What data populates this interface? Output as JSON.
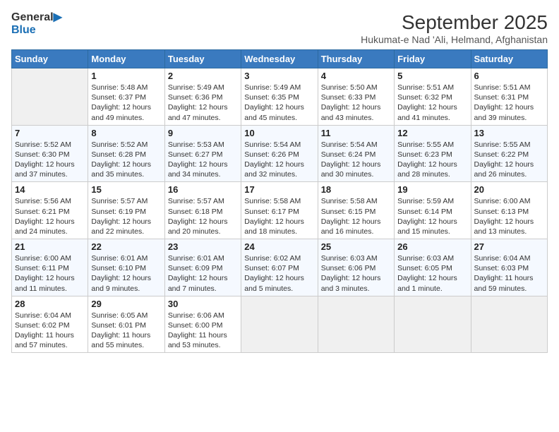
{
  "header": {
    "logo_general": "General",
    "logo_blue": "Blue",
    "month_year": "September 2025",
    "location": "Hukumat-e Nad 'Ali, Helmand, Afghanistan"
  },
  "weekdays": [
    "Sunday",
    "Monday",
    "Tuesday",
    "Wednesday",
    "Thursday",
    "Friday",
    "Saturday"
  ],
  "weeks": [
    [
      {
        "day": "",
        "info": ""
      },
      {
        "day": "1",
        "info": "Sunrise: 5:48 AM\nSunset: 6:37 PM\nDaylight: 12 hours\nand 49 minutes."
      },
      {
        "day": "2",
        "info": "Sunrise: 5:49 AM\nSunset: 6:36 PM\nDaylight: 12 hours\nand 47 minutes."
      },
      {
        "day": "3",
        "info": "Sunrise: 5:49 AM\nSunset: 6:35 PM\nDaylight: 12 hours\nand 45 minutes."
      },
      {
        "day": "4",
        "info": "Sunrise: 5:50 AM\nSunset: 6:33 PM\nDaylight: 12 hours\nand 43 minutes."
      },
      {
        "day": "5",
        "info": "Sunrise: 5:51 AM\nSunset: 6:32 PM\nDaylight: 12 hours\nand 41 minutes."
      },
      {
        "day": "6",
        "info": "Sunrise: 5:51 AM\nSunset: 6:31 PM\nDaylight: 12 hours\nand 39 minutes."
      }
    ],
    [
      {
        "day": "7",
        "info": "Sunrise: 5:52 AM\nSunset: 6:30 PM\nDaylight: 12 hours\nand 37 minutes."
      },
      {
        "day": "8",
        "info": "Sunrise: 5:52 AM\nSunset: 6:28 PM\nDaylight: 12 hours\nand 35 minutes."
      },
      {
        "day": "9",
        "info": "Sunrise: 5:53 AM\nSunset: 6:27 PM\nDaylight: 12 hours\nand 34 minutes."
      },
      {
        "day": "10",
        "info": "Sunrise: 5:54 AM\nSunset: 6:26 PM\nDaylight: 12 hours\nand 32 minutes."
      },
      {
        "day": "11",
        "info": "Sunrise: 5:54 AM\nSunset: 6:24 PM\nDaylight: 12 hours\nand 30 minutes."
      },
      {
        "day": "12",
        "info": "Sunrise: 5:55 AM\nSunset: 6:23 PM\nDaylight: 12 hours\nand 28 minutes."
      },
      {
        "day": "13",
        "info": "Sunrise: 5:55 AM\nSunset: 6:22 PM\nDaylight: 12 hours\nand 26 minutes."
      }
    ],
    [
      {
        "day": "14",
        "info": "Sunrise: 5:56 AM\nSunset: 6:21 PM\nDaylight: 12 hours\nand 24 minutes."
      },
      {
        "day": "15",
        "info": "Sunrise: 5:57 AM\nSunset: 6:19 PM\nDaylight: 12 hours\nand 22 minutes."
      },
      {
        "day": "16",
        "info": "Sunrise: 5:57 AM\nSunset: 6:18 PM\nDaylight: 12 hours\nand 20 minutes."
      },
      {
        "day": "17",
        "info": "Sunrise: 5:58 AM\nSunset: 6:17 PM\nDaylight: 12 hours\nand 18 minutes."
      },
      {
        "day": "18",
        "info": "Sunrise: 5:58 AM\nSunset: 6:15 PM\nDaylight: 12 hours\nand 16 minutes."
      },
      {
        "day": "19",
        "info": "Sunrise: 5:59 AM\nSunset: 6:14 PM\nDaylight: 12 hours\nand 15 minutes."
      },
      {
        "day": "20",
        "info": "Sunrise: 6:00 AM\nSunset: 6:13 PM\nDaylight: 12 hours\nand 13 minutes."
      }
    ],
    [
      {
        "day": "21",
        "info": "Sunrise: 6:00 AM\nSunset: 6:11 PM\nDaylight: 12 hours\nand 11 minutes."
      },
      {
        "day": "22",
        "info": "Sunrise: 6:01 AM\nSunset: 6:10 PM\nDaylight: 12 hours\nand 9 minutes."
      },
      {
        "day": "23",
        "info": "Sunrise: 6:01 AM\nSunset: 6:09 PM\nDaylight: 12 hours\nand 7 minutes."
      },
      {
        "day": "24",
        "info": "Sunrise: 6:02 AM\nSunset: 6:07 PM\nDaylight: 12 hours\nand 5 minutes."
      },
      {
        "day": "25",
        "info": "Sunrise: 6:03 AM\nSunset: 6:06 PM\nDaylight: 12 hours\nand 3 minutes."
      },
      {
        "day": "26",
        "info": "Sunrise: 6:03 AM\nSunset: 6:05 PM\nDaylight: 12 hours\nand 1 minute."
      },
      {
        "day": "27",
        "info": "Sunrise: 6:04 AM\nSunset: 6:03 PM\nDaylight: 11 hours\nand 59 minutes."
      }
    ],
    [
      {
        "day": "28",
        "info": "Sunrise: 6:04 AM\nSunset: 6:02 PM\nDaylight: 11 hours\nand 57 minutes."
      },
      {
        "day": "29",
        "info": "Sunrise: 6:05 AM\nSunset: 6:01 PM\nDaylight: 11 hours\nand 55 minutes."
      },
      {
        "day": "30",
        "info": "Sunrise: 6:06 AM\nSunset: 6:00 PM\nDaylight: 11 hours\nand 53 minutes."
      },
      {
        "day": "",
        "info": ""
      },
      {
        "day": "",
        "info": ""
      },
      {
        "day": "",
        "info": ""
      },
      {
        "day": "",
        "info": ""
      }
    ]
  ]
}
